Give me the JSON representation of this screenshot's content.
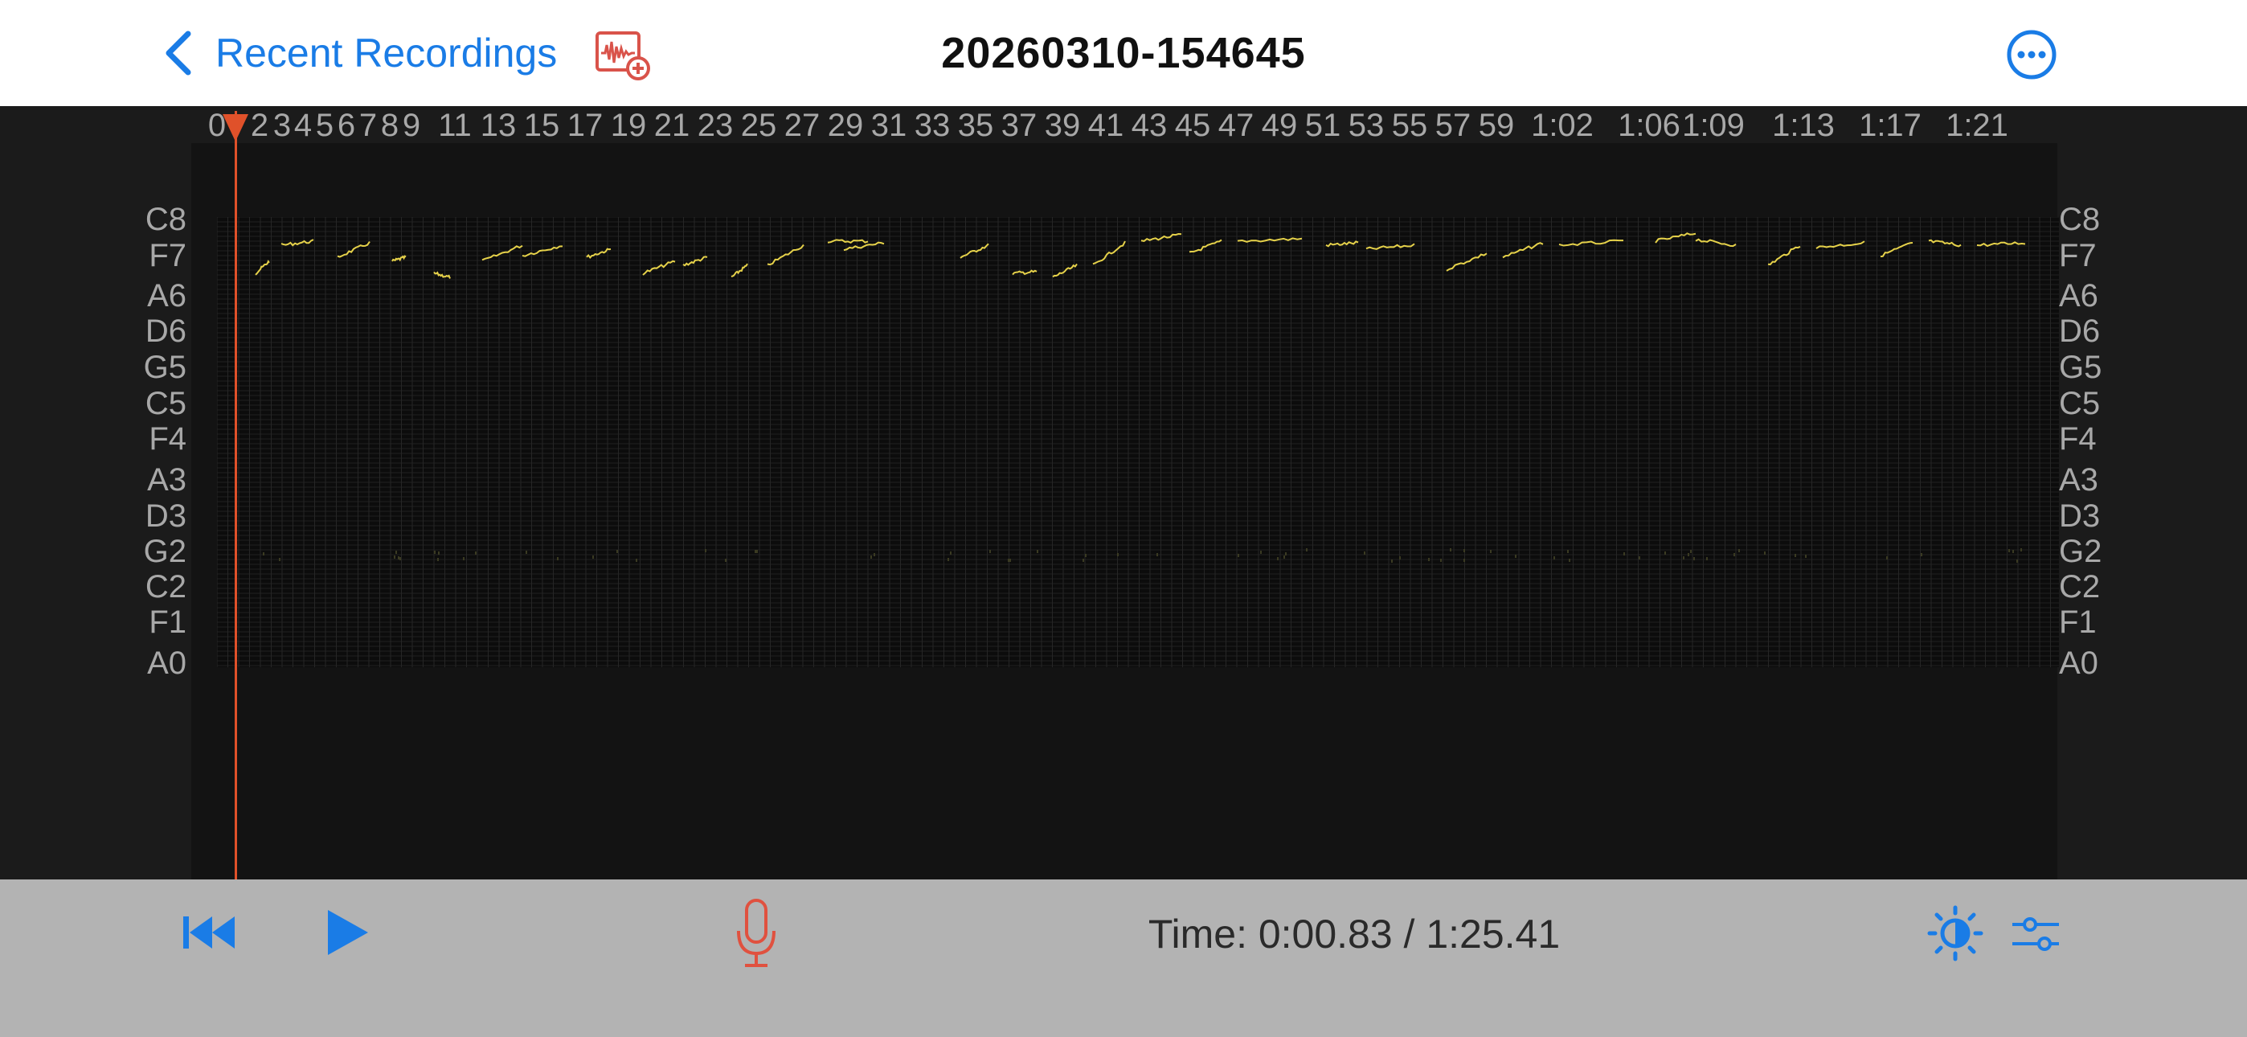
{
  "header": {
    "back_label": "Recent Recordings",
    "title": "20260310-154645"
  },
  "timeline": {
    "labels": [
      "0",
      "2",
      "3",
      "4",
      "5",
      "6",
      "7",
      "8",
      "9",
      "11",
      "13",
      "15",
      "17",
      "19",
      "21",
      "23",
      "25",
      "27",
      "29",
      "31",
      "33",
      "35",
      "37",
      "39",
      "41",
      "43",
      "45",
      "47",
      "49",
      "51",
      "53",
      "55",
      "57",
      "59",
      "1:02",
      "1:06",
      "1:09",
      "1:13",
      "1:17",
      "1:21"
    ]
  },
  "notes": [
    "C8",
    "F7",
    "A6",
    "D6",
    "G5",
    "C5",
    "F4",
    "A3",
    "D3",
    "G2",
    "C2",
    "F1",
    "A0"
  ],
  "playback": {
    "time_text": "Time: 0:00.83 / 1:25.41"
  },
  "colors": {
    "accent": "#1a7ce6",
    "playhead": "#e0512a",
    "pitch_trace": "#e6d24a",
    "mic": "#e0513f"
  },
  "icons": {
    "back": "chevron-left-icon",
    "add_recording": "waveform-add-icon",
    "more": "ellipsis-circle-icon",
    "rewind": "skip-to-start-icon",
    "play": "play-icon",
    "mic": "microphone-icon",
    "brightness": "brightness-icon",
    "settings": "sliders-icon"
  }
}
